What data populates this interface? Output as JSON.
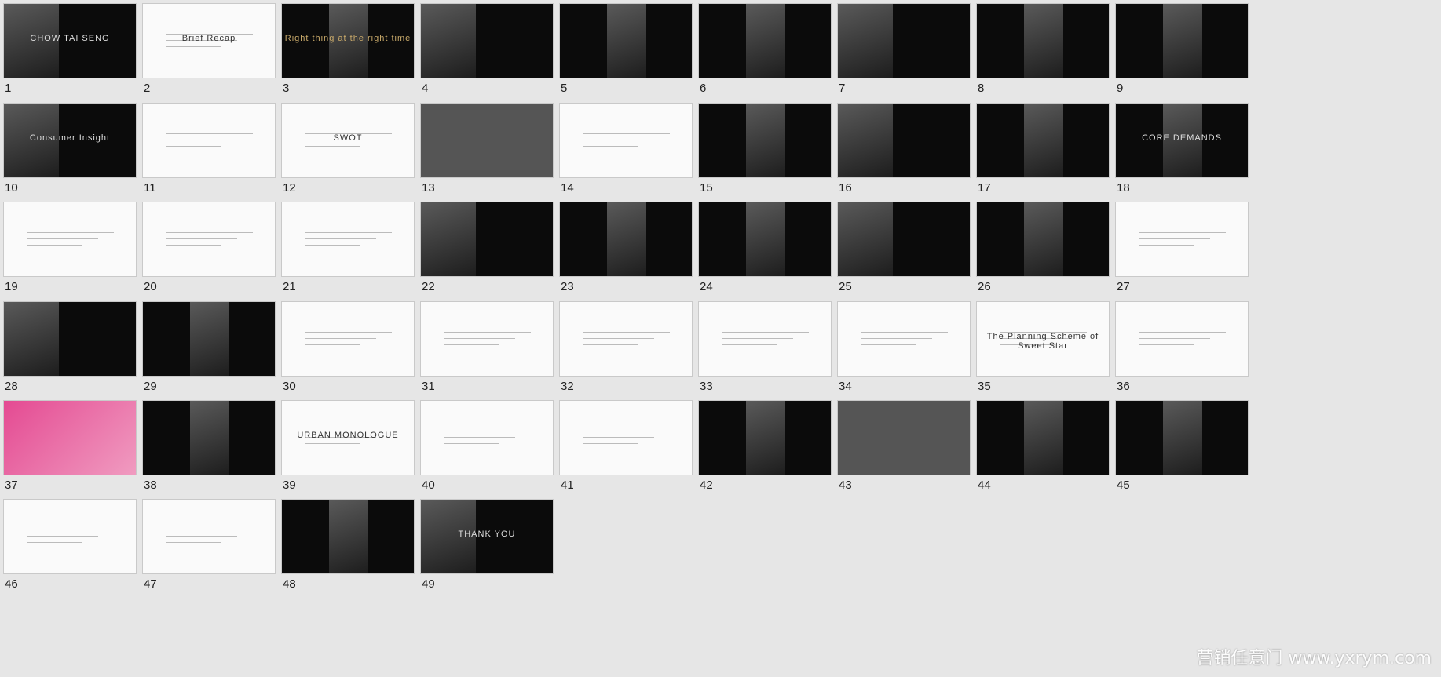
{
  "slides": [
    {
      "n": "1",
      "title": "CHOW TAI SENG"
    },
    {
      "n": "2",
      "title": "Brief Recap"
    },
    {
      "n": "3",
      "title": "Right thing at the right time"
    },
    {
      "n": "4",
      "title": ""
    },
    {
      "n": "5",
      "title": ""
    },
    {
      "n": "6",
      "title": ""
    },
    {
      "n": "7",
      "title": ""
    },
    {
      "n": "8",
      "title": ""
    },
    {
      "n": "9",
      "title": ""
    },
    {
      "n": "10",
      "title": "Consumer Insight"
    },
    {
      "n": "11",
      "title": ""
    },
    {
      "n": "12",
      "title": "SWOT"
    },
    {
      "n": "13",
      "title": ""
    },
    {
      "n": "14",
      "title": ""
    },
    {
      "n": "15",
      "title": ""
    },
    {
      "n": "16",
      "title": ""
    },
    {
      "n": "17",
      "title": ""
    },
    {
      "n": "18",
      "title": "CORE DEMANDS"
    },
    {
      "n": "19",
      "title": ""
    },
    {
      "n": "20",
      "title": ""
    },
    {
      "n": "21",
      "title": ""
    },
    {
      "n": "22",
      "title": ""
    },
    {
      "n": "23",
      "title": ""
    },
    {
      "n": "24",
      "title": ""
    },
    {
      "n": "25",
      "title": ""
    },
    {
      "n": "26",
      "title": ""
    },
    {
      "n": "27",
      "title": ""
    },
    {
      "n": "28",
      "title": ""
    },
    {
      "n": "29",
      "title": ""
    },
    {
      "n": "30",
      "title": ""
    },
    {
      "n": "31",
      "title": ""
    },
    {
      "n": "32",
      "title": ""
    },
    {
      "n": "33",
      "title": ""
    },
    {
      "n": "34",
      "title": ""
    },
    {
      "n": "35",
      "title": "The Planning Scheme of Sweet Star"
    },
    {
      "n": "36",
      "title": ""
    },
    {
      "n": "37",
      "title": ""
    },
    {
      "n": "38",
      "title": ""
    },
    {
      "n": "39",
      "title": "URBAN MONOLOGUE"
    },
    {
      "n": "40",
      "title": ""
    },
    {
      "n": "41",
      "title": ""
    },
    {
      "n": "42",
      "title": ""
    },
    {
      "n": "43",
      "title": ""
    },
    {
      "n": "44",
      "title": ""
    },
    {
      "n": "45",
      "title": ""
    },
    {
      "n": "46",
      "title": ""
    },
    {
      "n": "47",
      "title": ""
    },
    {
      "n": "48",
      "title": ""
    },
    {
      "n": "49",
      "title": "THANK YOU"
    }
  ],
  "watermark": "营销任意门 www.yxrym.com"
}
